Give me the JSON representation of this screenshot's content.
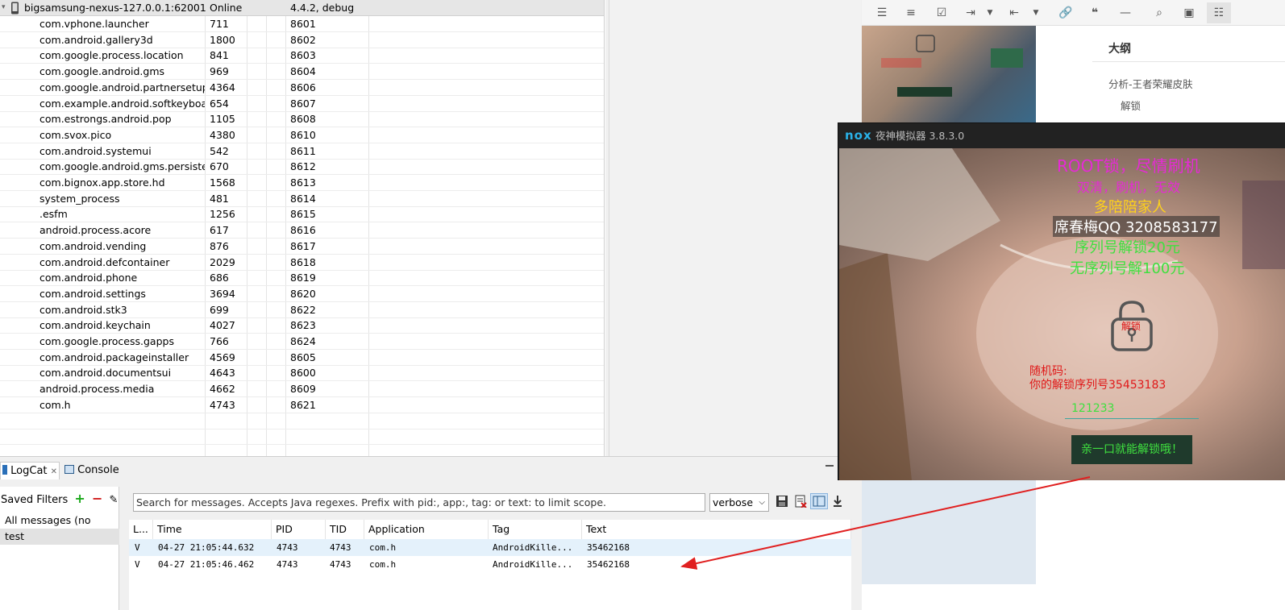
{
  "device": {
    "name": "bigsamsung-nexus-127.0.0.1:62001",
    "status": "Online",
    "build": "4.4.2, debug"
  },
  "processes": [
    {
      "name": "com.vphone.launcher",
      "pid": "711",
      "port": "8601"
    },
    {
      "name": "com.android.gallery3d",
      "pid": "1800",
      "port": "8602"
    },
    {
      "name": "com.google.process.location",
      "pid": "841",
      "port": "8603"
    },
    {
      "name": "com.google.android.gms",
      "pid": "969",
      "port": "8604"
    },
    {
      "name": "com.google.android.partnersetup",
      "pid": "4364",
      "port": "8606"
    },
    {
      "name": "com.example.android.softkeyboard",
      "pid": "654",
      "port": "8607"
    },
    {
      "name": "com.estrongs.android.pop",
      "pid": "1105",
      "port": "8608"
    },
    {
      "name": "com.svox.pico",
      "pid": "4380",
      "port": "8610"
    },
    {
      "name": "com.android.systemui",
      "pid": "542",
      "port": "8611"
    },
    {
      "name": "com.google.android.gms.persistent",
      "pid": "670",
      "port": "8612"
    },
    {
      "name": "com.bignox.app.store.hd",
      "pid": "1568",
      "port": "8613"
    },
    {
      "name": "system_process",
      "pid": "481",
      "port": "8614"
    },
    {
      "name": ".esfm",
      "pid": "1256",
      "port": "8615"
    },
    {
      "name": "android.process.acore",
      "pid": "617",
      "port": "8616"
    },
    {
      "name": "com.android.vending",
      "pid": "876",
      "port": "8617"
    },
    {
      "name": "com.android.defcontainer",
      "pid": "2029",
      "port": "8618"
    },
    {
      "name": "com.android.phone",
      "pid": "686",
      "port": "8619"
    },
    {
      "name": "com.android.settings",
      "pid": "3694",
      "port": "8620"
    },
    {
      "name": "com.android.stk3",
      "pid": "699",
      "port": "8622"
    },
    {
      "name": "com.android.keychain",
      "pid": "4027",
      "port": "8623"
    },
    {
      "name": "com.google.process.gapps",
      "pid": "766",
      "port": "8624"
    },
    {
      "name": "com.android.packageinstaller",
      "pid": "4569",
      "port": "8605"
    },
    {
      "name": "com.android.documentsui",
      "pid": "4643",
      "port": "8600"
    },
    {
      "name": "android.process.media",
      "pid": "4662",
      "port": "8609"
    },
    {
      "name": "com.h",
      "pid": "4743",
      "port": "8621"
    }
  ],
  "tabs": {
    "logcat": "LogCat",
    "console": "Console"
  },
  "filters": {
    "title": "Saved Filters",
    "items": [
      "All messages (no filters)",
      "test"
    ]
  },
  "search": {
    "placeholder": "Search for messages. Accepts Java regexes. Prefix with pid:, app:, tag: or text: to limit scope."
  },
  "level_select": "verbose",
  "log_headers": [
    "L...",
    "Time",
    "PID",
    "TID",
    "Application",
    "Tag",
    "Text"
  ],
  "log_rows": [
    {
      "level": "V",
      "time": "04-27 21:05:44.632",
      "pid": "4743",
      "tid": "4743",
      "app": "com.h",
      "tag": "AndroidKille...",
      "text": "35462168"
    },
    {
      "level": "V",
      "time": "04-27 21:05:46.462",
      "pid": "4743",
      "tid": "4743",
      "app": "com.h",
      "tag": "AndroidKille...",
      "text": "35462168"
    }
  ],
  "outline": {
    "title": "大纲",
    "items": [
      "分析-王者荣耀皮肤",
      "解锁"
    ]
  },
  "nox": {
    "logo": "nox",
    "title": "夜神模拟器 3.8.3.0"
  },
  "ransom": {
    "line1": "ROOT锁，尽情刷机",
    "line2": "双清，刷机，无效",
    "line3": "多陪陪家人",
    "line4": "席春梅QQ 3208583177",
    "line5": "序列号解锁20元",
    "line6": "无序列号解100元",
    "lock_label": "解锁",
    "random_label": "随机码:",
    "serial_text": "你的解锁序列号35453183",
    "input_value": "121233",
    "button": "亲一口就能解锁哦！"
  },
  "colors": {
    "magenta": "#e62ad6",
    "green": "#3fe03f",
    "yellow": "#ffd21a",
    "red": "#e01818",
    "arrow": "#e02020"
  }
}
